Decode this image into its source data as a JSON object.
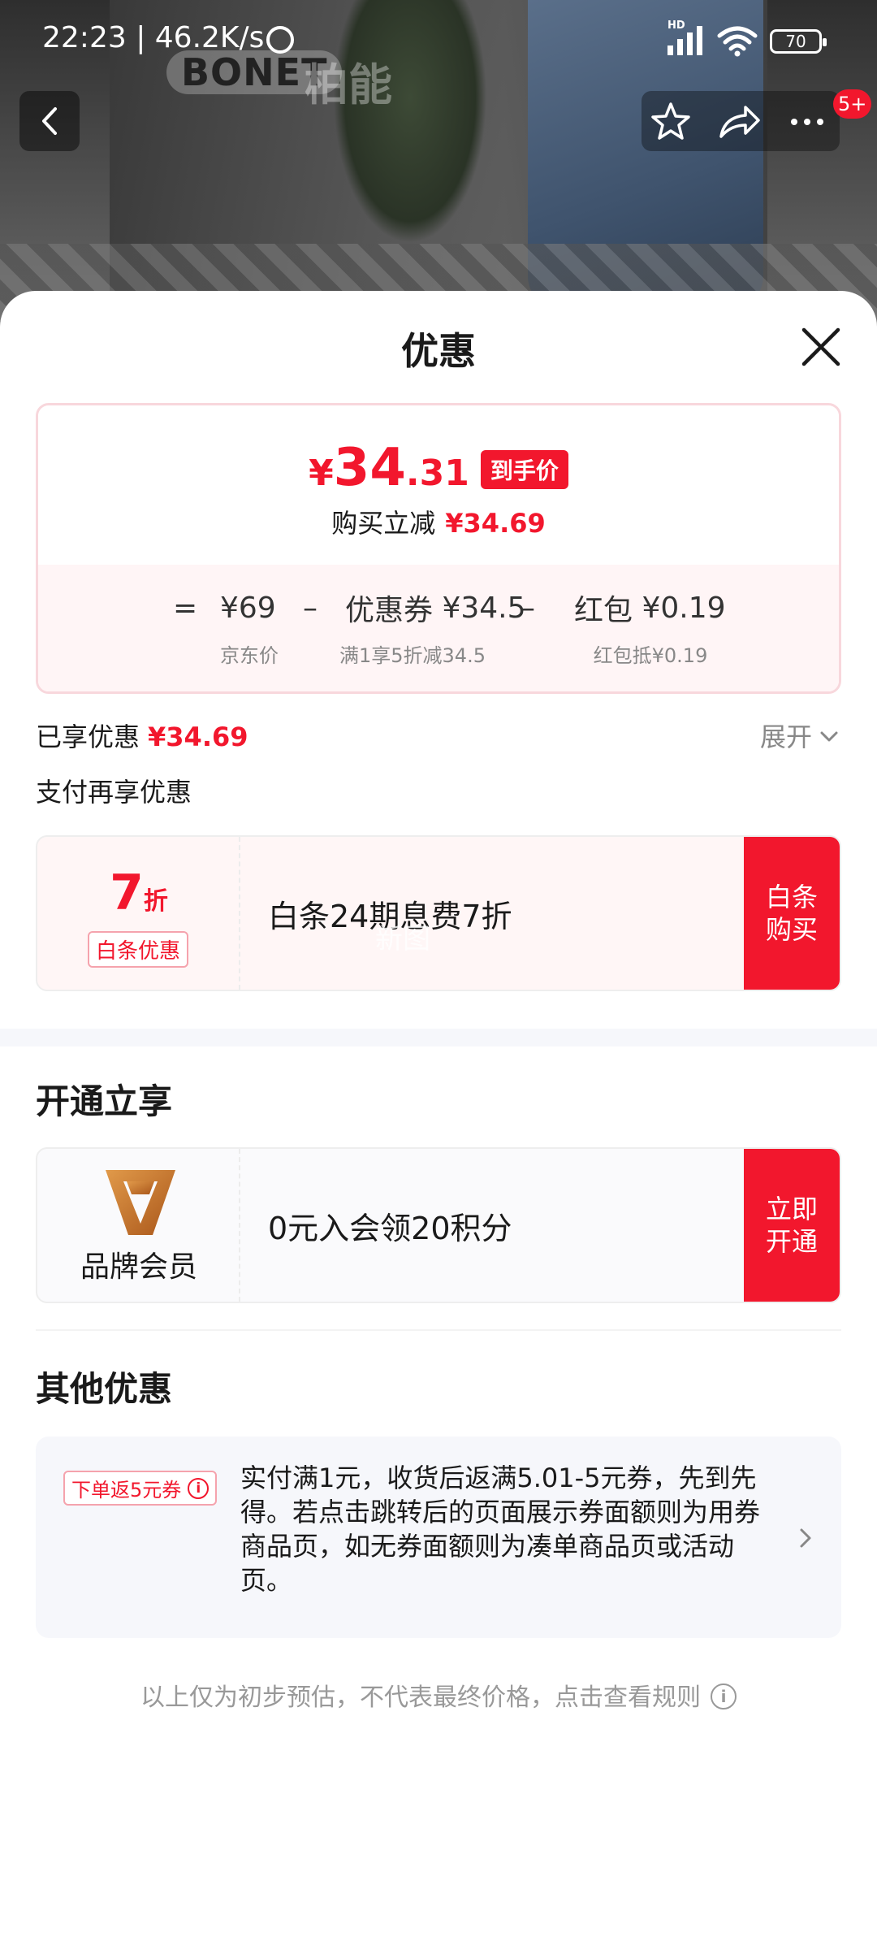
{
  "status_bar": {
    "time_speed": "22:23 | 46.2K/s",
    "network_label": "HD",
    "battery": "70"
  },
  "header_image": {
    "brand_en": "BONET",
    "brand_cn": "柏能",
    "cart_badge": "5+"
  },
  "sheet": {
    "title": "优惠"
  },
  "price_card": {
    "currency": "¥",
    "final_int": "34",
    "final_dec": ".31",
    "final_tag": "到手价",
    "reduce_label": "购买立减",
    "reduce_amount": "¥34.69",
    "eq": "=",
    "jd_price": "¥69",
    "jd_price_label": "京东价",
    "minus": "–",
    "coupon_name": "优惠券",
    "coupon_amount": "¥34.5",
    "coupon_label": "满1享5折减34.5",
    "redpack_name": "红包",
    "redpack_amount": "¥0.19",
    "redpack_label": "红包抵¥0.19"
  },
  "enjoyed": {
    "label": "已享优惠",
    "amount": "¥34.69",
    "expand": "展开"
  },
  "pay_offers": {
    "title": "支付再享优惠",
    "discount_num": "7",
    "discount_unit": "折",
    "discount_tag": "白条优惠",
    "text": "白条24期息费7折",
    "button": "白条购买",
    "watermark": "新图"
  },
  "membership": {
    "title": "开通立享",
    "brand_label": "品牌会员",
    "text": "0元入会领20积分",
    "button": "立即开通"
  },
  "other": {
    "title": "其他优惠",
    "tag": "下单返5元券",
    "text": "实付满1元，收货后返满5.01-5元券，先到先得。若点击跳转后的页面展示券面额则为用券商品页，如无券面额则为凑单商品页或活动页。"
  },
  "footnote": "以上仅为初步预估，不代表最终价格，点击查看规则",
  "colors": {
    "accent": "#f2172d",
    "gold": "#c8741f"
  }
}
